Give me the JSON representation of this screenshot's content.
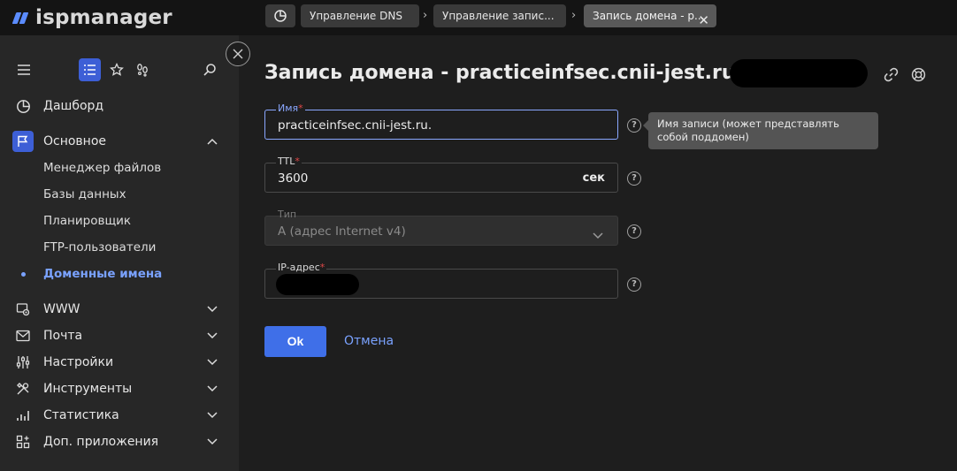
{
  "app": {
    "logo_text": "ispmanager"
  },
  "breadcrumbs": [
    {
      "label": "Управление DNS"
    },
    {
      "label": "Управление запис..."
    },
    {
      "label": "Запись домена - p..."
    }
  ],
  "sidebar": {
    "items": [
      {
        "label": "Дашборд",
        "icon": "dashboard-icon"
      },
      {
        "label": "Основное",
        "icon": "flag-icon",
        "expanded": true
      },
      {
        "label": "Менеджер файлов"
      },
      {
        "label": "Базы данных"
      },
      {
        "label": "Планировщик"
      },
      {
        "label": "FTP-пользователи"
      },
      {
        "label": "Доменные имена",
        "active": true
      },
      {
        "label": "WWW",
        "icon": "www-icon"
      },
      {
        "label": "Почта",
        "icon": "mail-icon"
      },
      {
        "label": "Настройки",
        "icon": "settings-sliders-icon"
      },
      {
        "label": "Инструменты",
        "icon": "tools-icon"
      },
      {
        "label": "Статистика",
        "icon": "stats-icon"
      },
      {
        "label": "Доп. приложения",
        "icon": "apps-icon"
      }
    ]
  },
  "page": {
    "title": "Запись домена - practiceinfsec.cnii-jest.ru. A"
  },
  "form": {
    "name": {
      "label": "Имя",
      "required": "*",
      "value": "practiceinfsec.cnii-jest.ru."
    },
    "ttl": {
      "label": "TTL",
      "required": "*",
      "value": "3600",
      "unit": "сек"
    },
    "type": {
      "label": "Тип",
      "value": "A (адрес Internet v4)"
    },
    "ip": {
      "label": "IP-адрес",
      "required": "*"
    },
    "help_glyph": "?"
  },
  "tooltip": {
    "text": "Имя записи (может представлять собой поддомен)"
  },
  "buttons": {
    "ok": "Ok",
    "cancel": "Отмена"
  },
  "colors": {
    "accent": "#3f6fe8",
    "link": "#7aa2ff",
    "required": "#e04848",
    "background": "#1e1e1e",
    "sidebar": "#272727"
  }
}
